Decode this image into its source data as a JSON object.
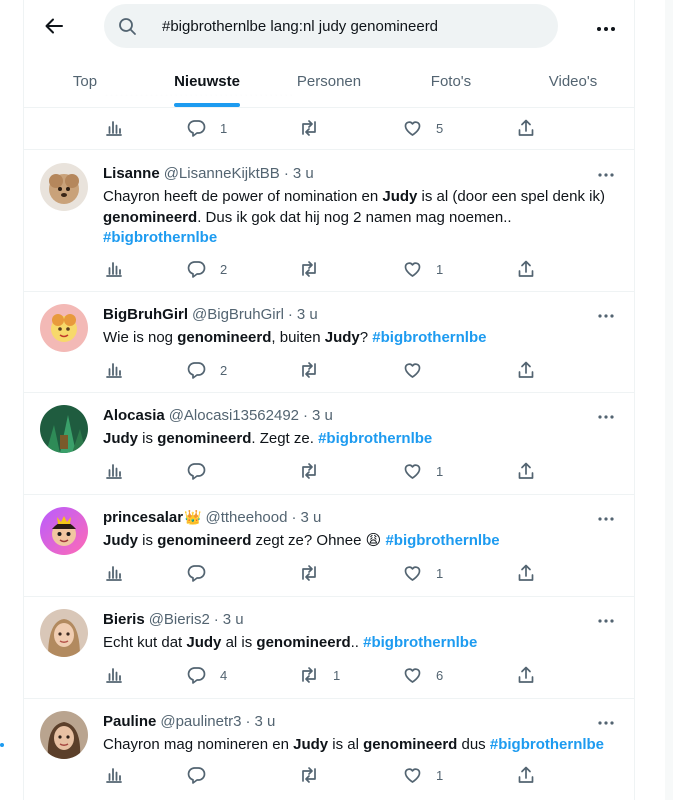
{
  "search": {
    "query": "#bigbrothernlbe lang:nl judy genomineerd"
  },
  "tabs": [
    "Top",
    "Nieuwste",
    "Personen",
    "Foto's",
    "Video's"
  ],
  "first_partial": {
    "reply_count": "1",
    "like_count": "5"
  },
  "tweets": [
    {
      "name": "Lisanne",
      "handle": "@LisanneKijktBB",
      "time": "3 u",
      "body": [
        {
          "t": "Chayron heeft de power of nomination en "
        },
        {
          "t": "Judy",
          "b": true
        },
        {
          "t": " is al (door een spel denk ik) "
        },
        {
          "t": "genomineerd",
          "b": true
        },
        {
          "t": ". Dus ik gok dat hij nog 2 namen mag noemen.. "
        },
        {
          "t": "#bigbrothernlbe",
          "tag": true
        }
      ],
      "replies": "2",
      "retweets": "",
      "likes": "1"
    },
    {
      "name": "BigBruhGirl",
      "handle": "@BigBruhGirl",
      "time": "3 u",
      "body": [
        {
          "t": "Wie is nog "
        },
        {
          "t": "genomineerd",
          "b": true
        },
        {
          "t": ", buiten "
        },
        {
          "t": "Judy",
          "b": true
        },
        {
          "t": "? "
        },
        {
          "t": "#bigbrothernlbe",
          "tag": true
        }
      ],
      "replies": "2",
      "retweets": "",
      "likes": ""
    },
    {
      "name": "Alocasia",
      "handle": "@Alocasi13562492",
      "time": "3 u",
      "body": [
        {
          "t": "Judy",
          "b": true
        },
        {
          "t": " is "
        },
        {
          "t": "genomineerd",
          "b": true
        },
        {
          "t": ". Zegt ze. "
        },
        {
          "t": "#bigbrothernlbe",
          "tag": true
        }
      ],
      "replies": "",
      "retweets": "",
      "likes": "1"
    },
    {
      "name": "princesalar",
      "badge": "👑",
      "handle": "@ttheehood",
      "time": "3 u",
      "body": [
        {
          "t": "Judy",
          "b": true
        },
        {
          "t": " is "
        },
        {
          "t": "genomineerd",
          "b": true
        },
        {
          "t": " zegt ze? Ohnee 😩 "
        },
        {
          "t": "#bigbrothernlbe",
          "tag": true
        }
      ],
      "replies": "",
      "retweets": "",
      "likes": "1"
    },
    {
      "name": "Bieris",
      "handle": "@Bieris2",
      "time": "3 u",
      "body": [
        {
          "t": "Echt kut dat "
        },
        {
          "t": "Judy",
          "b": true
        },
        {
          "t": " al is "
        },
        {
          "t": "genomineerd",
          "b": true
        },
        {
          "t": ".. "
        },
        {
          "t": "#bigbrothernlbe",
          "tag": true
        }
      ],
      "replies": "4",
      "retweets": "1",
      "likes": "6"
    },
    {
      "name": "Pauline",
      "handle": "@paulinetr3",
      "time": "3 u",
      "body": [
        {
          "t": "Chayron mag nomineren en "
        },
        {
          "t": "Judy",
          "b": true
        },
        {
          "t": " is al "
        },
        {
          "t": "genomineerd",
          "b": true
        },
        {
          "t": " dus "
        },
        {
          "t": "#bigbrothernlbe",
          "tag": true
        }
      ],
      "replies": "",
      "retweets": "",
      "likes": "1"
    }
  ],
  "colors": {
    "accent": "#1d9bf0",
    "text": "#0f1419",
    "muted": "#536471",
    "border": "#eff3f4"
  }
}
